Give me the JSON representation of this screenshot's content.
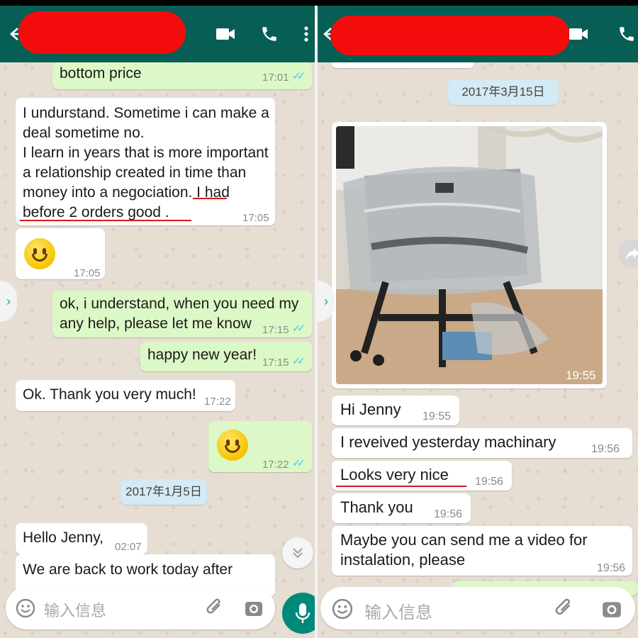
{
  "left": {
    "header": {
      "contact_name": "[redacted]"
    },
    "messages": [
      {
        "text": "bottom price",
        "time": "17:01",
        "dir": "out"
      },
      {
        "lines": [
          "I undurstand. Sometime i can make a",
          "deal sometime no.",
          "I learn in years that is more important",
          "a relationship created in time than",
          "money into a negociation. I had",
          "before 2 orders good ."
        ],
        "time": "17:05",
        "dir": "in"
      },
      {
        "emoji": "slightly-smiling-face",
        "time": "17:05",
        "dir": "in"
      },
      {
        "lines": [
          "ok, i understand, when you need my",
          "any help, please let me know"
        ],
        "time": "17:15",
        "dir": "out"
      },
      {
        "text": "happy new year!",
        "time": "17:15",
        "dir": "out"
      },
      {
        "text": "Ok. Thank you very much!",
        "time": "17:22",
        "dir": "in"
      },
      {
        "emoji": "smiling-face",
        "time": "17:22",
        "dir": "out"
      },
      {
        "text": "Hello Jenny,",
        "time": "02:07",
        "dir": "in"
      },
      {
        "text": "We are back to work today after",
        "dir": "in"
      }
    ],
    "date_chip": "2017年1月5日",
    "input_placeholder": "输入信息"
  },
  "right": {
    "header": {
      "contact_name": "[redacted]"
    },
    "date_chip": "2017年3月15日",
    "photo_time": "19:55",
    "messages": [
      {
        "text": "Hi Jenny",
        "time": "19:55",
        "dir": "in"
      },
      {
        "text": "I reveived yesterday machinary",
        "time": "19:56",
        "dir": "in"
      },
      {
        "text": "Looks very nice",
        "time": "19:56",
        "dir": "in"
      },
      {
        "text": "Thank you",
        "time": "19:56",
        "dir": "in"
      },
      {
        "lines": [
          "Maybe you can send me a video for",
          "instalation, please"
        ],
        "time": "19:56",
        "dir": "in"
      }
    ],
    "input_placeholder": "输入信息"
  },
  "colors": {
    "header": "#075e54",
    "outgoing": "#dcf8c6",
    "incoming": "#ffffff",
    "read_ticks": "#4fc3f7",
    "redaction": "#f40c0c",
    "mic_button": "#00897b"
  }
}
